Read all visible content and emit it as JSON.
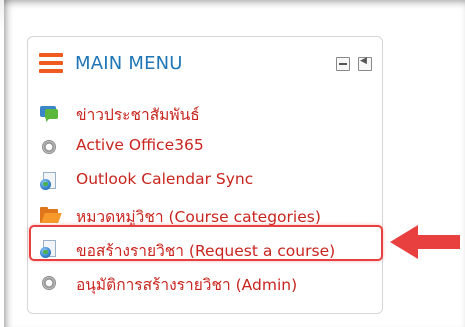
{
  "block": {
    "title": "MAIN MENU",
    "controls": [
      {
        "name": "minimize-icon",
        "label": "minimize"
      },
      {
        "name": "dock-icon",
        "label": "dock"
      }
    ]
  },
  "menu": {
    "items": [
      {
        "label": "ข่าวประชาสัมพันธ์",
        "icon": "chat-icon"
      },
      {
        "label": "Active Office365",
        "icon": "gear-icon"
      },
      {
        "label": "Outlook Calendar Sync",
        "icon": "web-page-icon"
      },
      {
        "label": "หมวดหมู่วิชา (Course categories)",
        "icon": "folder-icon"
      },
      {
        "label": "ขอสร้างรายวิชา (Request a course)",
        "icon": "web-page-icon",
        "highlighted": true
      },
      {
        "label": "อนุมัติการสร้างรายวิชา (Admin)",
        "icon": "gear-icon"
      }
    ]
  },
  "colors": {
    "title": "#1f75b6",
    "link": "#c9241e",
    "hamburger": "#f05a1e",
    "annotation": "#e8403f"
  }
}
